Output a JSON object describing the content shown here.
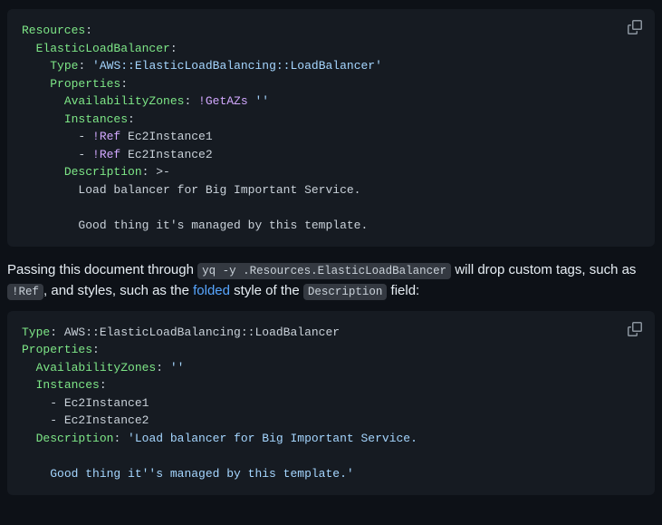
{
  "code1": {
    "l1": {
      "k": "Resources",
      "c": ":"
    },
    "l2": {
      "ind": "  ",
      "k": "ElasticLoadBalancer",
      "c": ":"
    },
    "l3": {
      "ind": "    ",
      "k": "Type",
      "c": ": ",
      "s": "'AWS::ElasticLoadBalancing::LoadBalancer'"
    },
    "l4": {
      "ind": "    ",
      "k": "Properties",
      "c": ":"
    },
    "l5": {
      "ind": "      ",
      "k": "AvailabilityZones",
      "c": ": ",
      "t": "!GetAZs",
      "sp": " ",
      "s": "''"
    },
    "l6": {
      "ind": "      ",
      "k": "Instances",
      "c": ":"
    },
    "l7": {
      "ind": "        - ",
      "t": "!Ref",
      "sp": " ",
      "p": "Ec2Instance1"
    },
    "l8": {
      "ind": "        - ",
      "t": "!Ref",
      "sp": " ",
      "p": "Ec2Instance2"
    },
    "l9": {
      "ind": "      ",
      "k": "Description",
      "c": ": ",
      "p": ">-"
    },
    "l10": {
      "ind": "        ",
      "p": "Load balancer for Big Important Service."
    },
    "l11": "",
    "l12": {
      "ind": "        ",
      "p": "Good thing it's managed by this template."
    }
  },
  "para": {
    "t1": "Passing this document through ",
    "cmd": "yq -y .Resources.ElasticLoadBalancer",
    "t2": " will drop custom tags, such as ",
    "ref": "!Ref",
    "t3": ", and styles, such as the ",
    "link": "folded",
    "t4": " style of the ",
    "desc": "Description",
    "t5": " field:"
  },
  "code2": {
    "l1": {
      "k": "Type",
      "c": ": ",
      "p": "AWS::ElasticLoadBalancing::LoadBalancer"
    },
    "l2": {
      "k": "Properties",
      "c": ":"
    },
    "l3": {
      "ind": "  ",
      "k": "AvailabilityZones",
      "c": ": ",
      "s": "''"
    },
    "l4": {
      "ind": "  ",
      "k": "Instances",
      "c": ":"
    },
    "l5": {
      "ind": "    ",
      "p": "- ",
      "p2": "Ec2Instance1"
    },
    "l6": {
      "ind": "    ",
      "p": "- ",
      "p2": "Ec2Instance2"
    },
    "l7": {
      "ind": "  ",
      "k": "Description",
      "c": ": ",
      "s": "'Load balancer for Big Important Service."
    },
    "l8": "",
    "l9": {
      "ind": "    ",
      "s": "Good thing it''s managed by this template.'"
    }
  }
}
